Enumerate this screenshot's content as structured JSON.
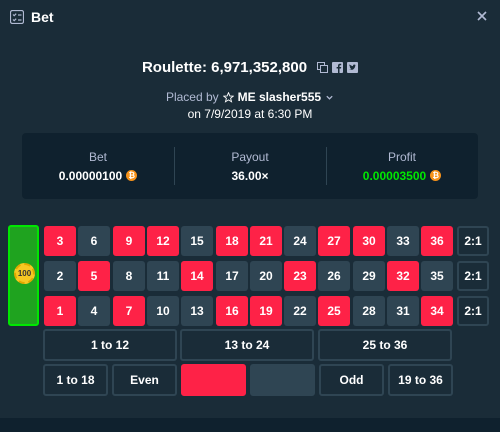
{
  "window": {
    "title": "Bet",
    "title_icon": "checklist-icon",
    "close_icon": "close-icon"
  },
  "heading": {
    "text": "Roulette: 6,971,352,800",
    "share_icons": [
      "copy-icon",
      "facebook-icon",
      "twitter-icon"
    ]
  },
  "placed": {
    "prefix": "Placed by",
    "user": "ME slasher555",
    "date": "on 7/9/2019 at 6:30 PM"
  },
  "stats": {
    "bet": {
      "label": "Bet",
      "value": "0.00000100"
    },
    "payout": {
      "label": "Payout",
      "value": "36.00×"
    },
    "profit": {
      "label": "Profit",
      "value": "0.00003500"
    },
    "currency_icon": "bitcoin-icon",
    "profit_color": "#00e701"
  },
  "board": {
    "zero_chip": "100",
    "rows": [
      [
        {
          "n": "3",
          "c": "red"
        },
        {
          "n": "6",
          "c": "black"
        },
        {
          "n": "9",
          "c": "red"
        },
        {
          "n": "12",
          "c": "red"
        },
        {
          "n": "15",
          "c": "black"
        },
        {
          "n": "18",
          "c": "red"
        },
        {
          "n": "21",
          "c": "red"
        },
        {
          "n": "24",
          "c": "black"
        },
        {
          "n": "27",
          "c": "red"
        },
        {
          "n": "30",
          "c": "red"
        },
        {
          "n": "33",
          "c": "black"
        },
        {
          "n": "36",
          "c": "red"
        }
      ],
      [
        {
          "n": "2",
          "c": "black"
        },
        {
          "n": "5",
          "c": "red"
        },
        {
          "n": "8",
          "c": "black"
        },
        {
          "n": "11",
          "c": "black"
        },
        {
          "n": "14",
          "c": "red"
        },
        {
          "n": "17",
          "c": "black"
        },
        {
          "n": "20",
          "c": "black"
        },
        {
          "n": "23",
          "c": "red"
        },
        {
          "n": "26",
          "c": "black"
        },
        {
          "n": "29",
          "c": "black"
        },
        {
          "n": "32",
          "c": "red"
        },
        {
          "n": "35",
          "c": "black"
        }
      ],
      [
        {
          "n": "1",
          "c": "red"
        },
        {
          "n": "4",
          "c": "black"
        },
        {
          "n": "7",
          "c": "red"
        },
        {
          "n": "10",
          "c": "black"
        },
        {
          "n": "13",
          "c": "black"
        },
        {
          "n": "16",
          "c": "red"
        },
        {
          "n": "19",
          "c": "red"
        },
        {
          "n": "22",
          "c": "black"
        },
        {
          "n": "25",
          "c": "red"
        },
        {
          "n": "28",
          "c": "black"
        },
        {
          "n": "31",
          "c": "black"
        },
        {
          "n": "34",
          "c": "red"
        }
      ]
    ],
    "column_bets": [
      "2:1",
      "2:1",
      "2:1"
    ],
    "dozens": [
      "1 to 12",
      "13 to 24",
      "25 to 36"
    ],
    "outside": [
      "1 to 18",
      "Even",
      "",
      "",
      "Odd",
      "19 to 36"
    ],
    "colors": {
      "red": "#fe2247",
      "black": "#2f4553",
      "green": "#1fa31f"
    }
  }
}
